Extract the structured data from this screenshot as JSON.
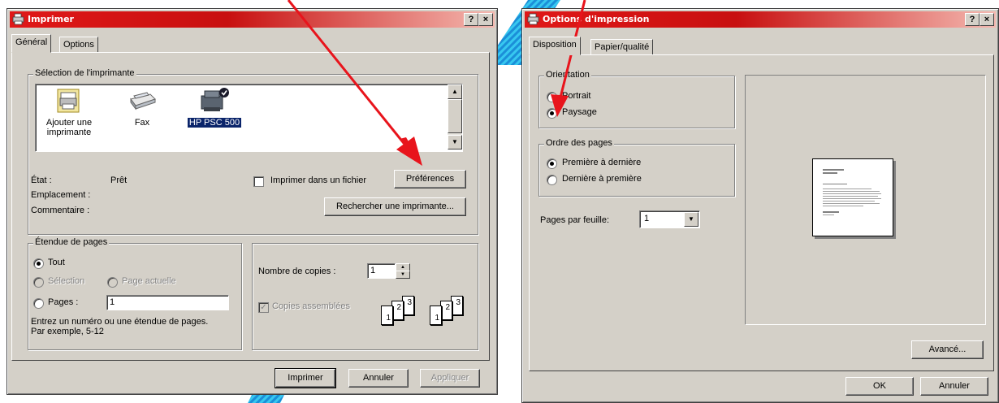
{
  "print_dialog": {
    "title": "Imprimer",
    "help_btn": "?",
    "close_btn": "×",
    "tabs": [
      {
        "label": "Général"
      },
      {
        "label": "Options"
      }
    ],
    "printer_selection": {
      "legend": "Sélection de l'imprimante",
      "printers": [
        {
          "label_line1": "Ajouter une",
          "label_line2": "imprimante",
          "icon": "add-printer-icon"
        },
        {
          "label_line1": "Fax",
          "label_line2": "",
          "icon": "fax-icon"
        },
        {
          "label_line1": "HP PSC 500",
          "label_line2": "",
          "icon": "printer-icon",
          "selected": true
        }
      ],
      "state_label": "État :",
      "state_value": "Prêt",
      "location_label": "Emplacement :",
      "comment_label": "Commentaire :",
      "print_to_file_label": "Imprimer dans un fichier",
      "preferences_btn": "Préférences",
      "find_printer_btn": "Rechercher une imprimante..."
    },
    "page_range": {
      "legend": "Étendue de pages",
      "all_label": "Tout",
      "selection_label": "Sélection",
      "current_page_label": "Page actuelle",
      "pages_label": "Pages :",
      "pages_value": "1",
      "hint_line1": "Entrez un numéro ou une étendue de pages.",
      "hint_line2": "Par exemple, 5-12"
    },
    "copies": {
      "count_label": "Nombre de copies :",
      "count_value": "1",
      "collate_label": "Copies assemblées",
      "n1": "1",
      "n2": "2",
      "n3": "3"
    },
    "buttons": {
      "print": "Imprimer",
      "cancel": "Annuler",
      "apply": "Appliquer"
    }
  },
  "options_dialog": {
    "title": "Options d'impression",
    "help_btn": "?",
    "close_btn": "×",
    "tabs": [
      {
        "label": "Disposition"
      },
      {
        "label": "Papier/qualité"
      }
    ],
    "orientation": {
      "legend": "Orientation",
      "portrait_label": "Portrait",
      "landscape_label": "Paysage"
    },
    "page_order": {
      "legend": "Ordre des pages",
      "first_to_last_label": "Première à dernière",
      "last_to_first_label": "Dernière à première"
    },
    "pages_per_sheet": {
      "label": "Pages par feuille:",
      "value": "1"
    },
    "buttons": {
      "advanced": "Avancé...",
      "ok": "OK",
      "cancel": "Annuler"
    }
  },
  "colors": {
    "annotation_arrow": "#e8141c",
    "title_bar": "#d01010",
    "selection": "#0a246a",
    "decor_stripes": "#37c8f0"
  }
}
